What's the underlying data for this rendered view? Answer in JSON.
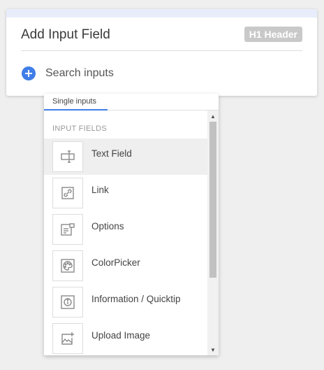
{
  "card": {
    "title": "Add Input Field",
    "badge": "H1 Header",
    "search_label": "Search inputs"
  },
  "dropdown": {
    "tab_label": "Single inputs",
    "section_label": "INPUT FIELDS",
    "items": [
      {
        "label": "Text Field",
        "icon": "text-field-icon"
      },
      {
        "label": "Link",
        "icon": "link-icon"
      },
      {
        "label": "Options",
        "icon": "options-icon"
      },
      {
        "label": "ColorPicker",
        "icon": "palette-icon"
      },
      {
        "label": "Information / Quicktip",
        "icon": "info-icon"
      },
      {
        "label": "Upload Image",
        "icon": "upload-image-icon"
      }
    ],
    "scroll_fraction": 0.7
  },
  "colors": {
    "accent": "#3f7ee8",
    "badge_bg": "#c9c9c9",
    "topbar": "#e8edfb"
  }
}
